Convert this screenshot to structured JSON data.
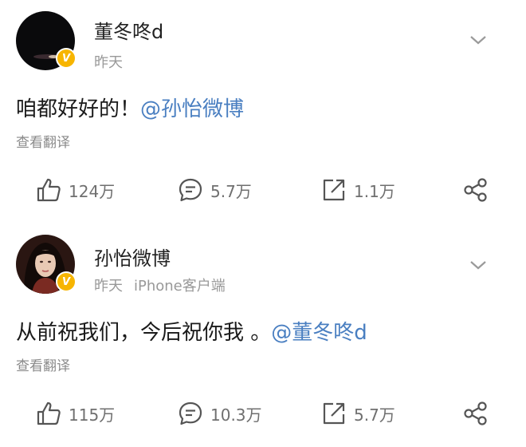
{
  "posts": [
    {
      "username": "董冬咚d",
      "time": "昨天",
      "source": "",
      "text": "咱都好好的！",
      "mention": "@孙怡微博",
      "translate": "查看翻译",
      "likes": "124万",
      "comments": "5.7万",
      "reposts": "1.1万",
      "verified": "V"
    },
    {
      "username": "孙怡微博",
      "time": "昨天",
      "source": "iPhone客户端",
      "text": "从前祝我们，今后祝你我 。",
      "mention": "@董冬咚d",
      "translate": "查看翻译",
      "likes": "115万",
      "comments": "10.3万",
      "reposts": "5.7万",
      "verified": "V"
    }
  ],
  "icons": [
    "chevron-down-icon",
    "thumbs-up-icon",
    "comment-icon",
    "repost-icon",
    "share-icon"
  ],
  "colors": {
    "mention": "#4a7fc1",
    "verified_badge": "#f7b500",
    "muted": "#8a8a8a"
  }
}
